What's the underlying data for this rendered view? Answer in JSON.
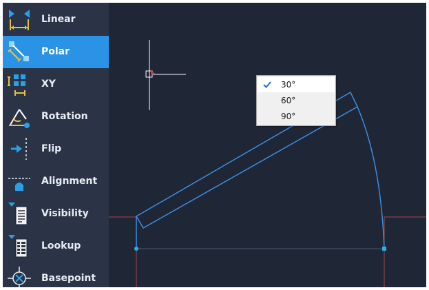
{
  "palette": {
    "active_index": 1,
    "items": [
      {
        "label": "Linear",
        "icon": "linear-parameter-icon"
      },
      {
        "label": "Polar",
        "icon": "polar-parameter-icon"
      },
      {
        "label": "XY",
        "icon": "xy-parameter-icon"
      },
      {
        "label": "Rotation",
        "icon": "rotation-parameter-icon"
      },
      {
        "label": "Flip",
        "icon": "flip-parameter-icon"
      },
      {
        "label": "Alignment",
        "icon": "alignment-parameter-icon"
      },
      {
        "label": "Visibility",
        "icon": "visibility-parameter-icon"
      },
      {
        "label": "Lookup",
        "icon": "lookup-parameter-icon"
      },
      {
        "label": "Basepoint",
        "icon": "basepoint-parameter-icon"
      }
    ]
  },
  "angle_menu": {
    "items": [
      {
        "label": "30°",
        "checked": true
      },
      {
        "label": "60°",
        "checked": false
      },
      {
        "label": "90°",
        "checked": false
      }
    ]
  },
  "colors": {
    "palette_background": "#2b3446",
    "active_item": "#2a93e6",
    "canvas_background": "#1f2636",
    "geometry_line": "#3a8ee0",
    "grip_point": "#2ab0e8",
    "boundary_line": "#a04848",
    "crosshair": "#ffffff",
    "icon_blue": "#2aa0e8",
    "icon_yellow": "#e8c040"
  }
}
